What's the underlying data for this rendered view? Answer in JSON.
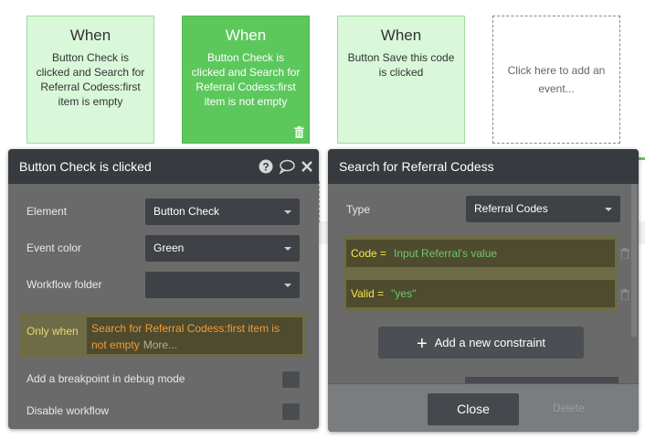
{
  "events": [
    {
      "when": "When",
      "text": "Button Check is clicked and Search for Referral Codess:first item is empty"
    },
    {
      "when": "When",
      "text": "Button Check is clicked and Search for Referral Codess:first item is not empty"
    },
    {
      "when": "When",
      "text": "Button Save this code is clicked"
    },
    {
      "text": "Click here to add an event..."
    }
  ],
  "left_panel": {
    "title": "Button Check is clicked",
    "element_label": "Element",
    "element_value": "Button Check",
    "color_label": "Event color",
    "color_value": "Green",
    "folder_label": "Workflow folder",
    "folder_value": "",
    "only_when_label": "Only when",
    "only_when_expr": "Search for Referral Codess:first item is not empty",
    "more_label": "More...",
    "breakpoint_label": "Add a breakpoint in debug mode",
    "disable_label": "Disable workflow"
  },
  "right_panel": {
    "title": "Search for Referral Codess",
    "type_label": "Type",
    "type_value": "Referral Codes",
    "constraints": [
      {
        "key": "Code =",
        "value": "Input Referral's value"
      },
      {
        "key": "Valid =",
        "value": "\"yes\""
      }
    ],
    "add_constraint_label": "Add a new constraint",
    "close_label": "Close",
    "delete_label": "Delete"
  },
  "colors": {
    "event_light": "#d9f7d9",
    "event_active": "#5cc85c",
    "panel_header": "#373b3f",
    "panel_body": "#6a6a6a",
    "expr_orange": "#f39c34",
    "constraint_key": "#f6e64a",
    "constraint_value": "#6cc86c"
  },
  "icons": [
    "help-icon",
    "comment-icon",
    "close-icon",
    "trash-icon",
    "plus-icon",
    "caret-down-icon"
  ]
}
